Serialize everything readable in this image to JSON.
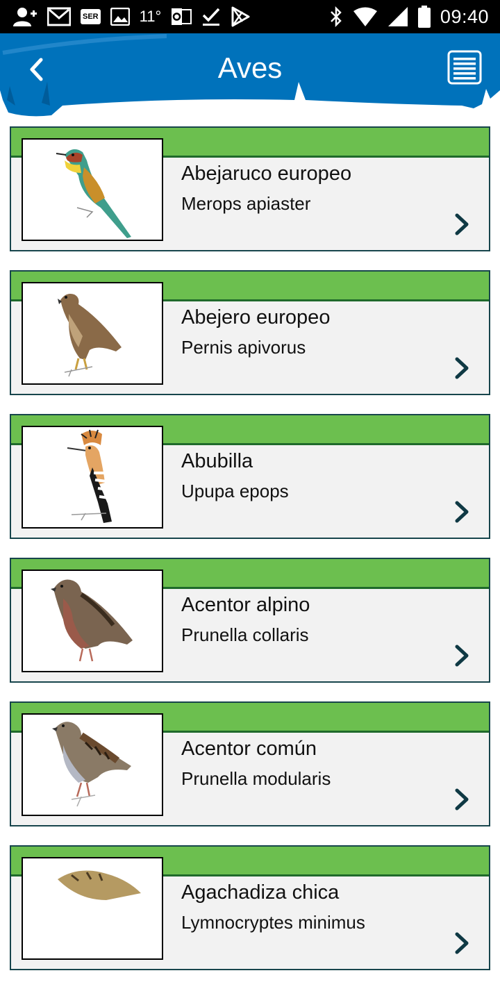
{
  "status_bar": {
    "temperature": "11°",
    "time": "09:40",
    "badge_text": "SER",
    "left_icons": [
      "add-user-icon",
      "gmail-icon",
      "ser-badge-icon",
      "image-icon",
      "temperature",
      "outlook-icon",
      "checkmark-icon",
      "play-store-icon"
    ],
    "right_icons": [
      "bluetooth-icon",
      "wifi-icon",
      "signal-icon",
      "battery-icon"
    ]
  },
  "header": {
    "title": "Aves",
    "back_icon": "chevron-left-icon",
    "menu_icon": "list-menu-icon",
    "bar_color": "#0072bb"
  },
  "colors": {
    "card_band": "#6cbf4f",
    "card_border": "#17454c",
    "card_bg": "#f2f2f2",
    "chevron": "#0f3944"
  },
  "birds": [
    {
      "common_name": "Abejaruco europeo",
      "scientific_name": "Merops apiaster"
    },
    {
      "common_name": "Abejero europeo",
      "scientific_name": "Pernis apivorus"
    },
    {
      "common_name": "Abubilla",
      "scientific_name": "Upupa epops"
    },
    {
      "common_name": "Acentor alpino",
      "scientific_name": "Prunella collaris"
    },
    {
      "common_name": "Acentor común",
      "scientific_name": "Prunella modularis"
    },
    {
      "common_name": "Agachadiza chica",
      "scientific_name": "Lymnocryptes minimus"
    }
  ]
}
